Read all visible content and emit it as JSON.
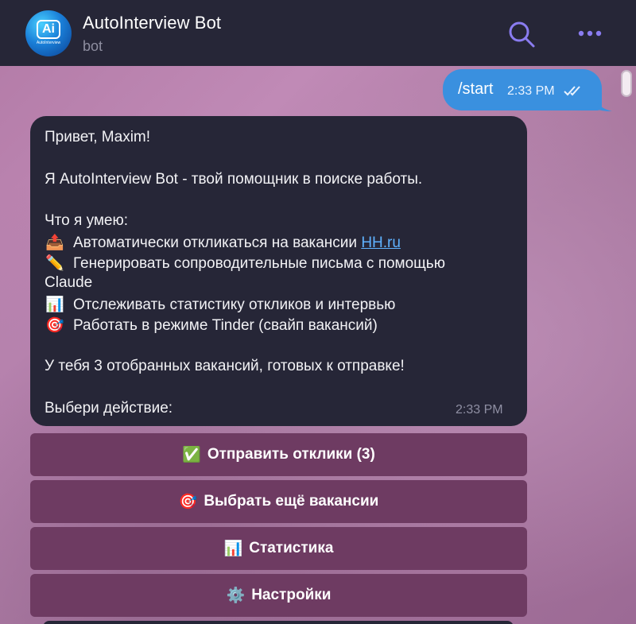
{
  "header": {
    "title": "AutoInterview Bot",
    "subtitle": "bot",
    "avatar_glyph": "Ai",
    "avatar_text": "AutoInterview",
    "search_icon": "search-icon",
    "more_icon": "more-icon"
  },
  "outgoing": {
    "text": "/start",
    "time": "2:33 PM",
    "status_icon": "double-check-icon"
  },
  "incoming": {
    "greeting": "Привет, Maxim!",
    "intro": "Я AutoInterview Bot - твой помощник в поиске работы.",
    "skills_title": "Что я умею:",
    "skill1_emoji": "📤",
    "skill1_text": "Автоматически откликаться на вакансии ",
    "skill1_link": "HH.ru",
    "skill2_emoji": "✏️",
    "skill2_text": "Генерировать сопроводительные письма с помощью",
    "skill2_cont": "Claude",
    "skill3_emoji": "📊",
    "skill3_text": "Отслеживать статистику откликов и интервью",
    "skill4_emoji": "🎯",
    "skill4_text": "Работать в режиме Tinder (свайп вакансий)",
    "status": "У тебя 3 отобранных вакансий, готовых к отправке!",
    "prompt": "Выбери действие:",
    "time": "2:33 PM"
  },
  "keyboard": [
    {
      "icon": "✅",
      "label": "Отправить отклики (3)"
    },
    {
      "icon": "🎯",
      "label": "Выбрать ещё вакансии"
    },
    {
      "icon": "📊",
      "label": "Статистика"
    },
    {
      "icon": "⚙️",
      "label": "Настройки"
    }
  ],
  "colors": {
    "header_bg": "#262637",
    "outgoing_bubble": "#3a90df",
    "incoming_bubble": "#262637",
    "keyboard_button": "#6e3b62",
    "link": "#5fb2ff",
    "icon_accent": "#8a7cf0"
  }
}
